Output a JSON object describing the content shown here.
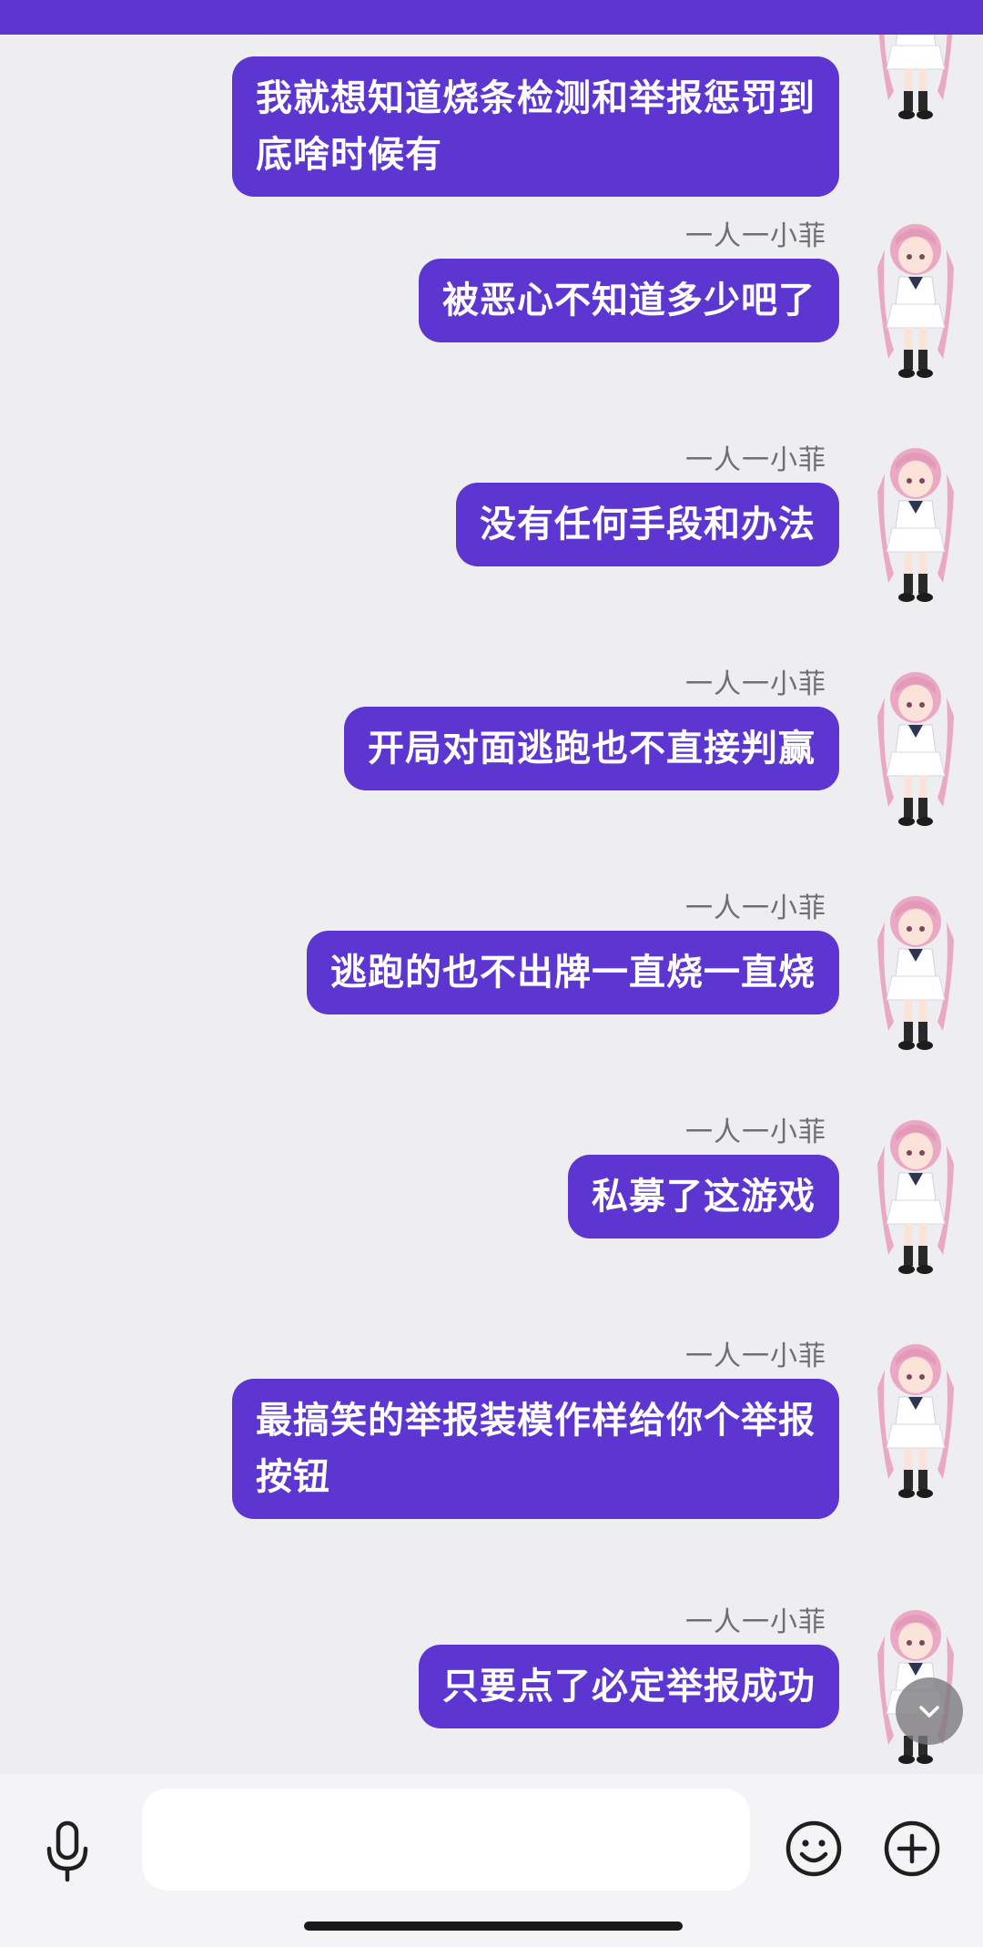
{
  "colors": {
    "bubble": "#5d35d1",
    "bubble_text": "#ffffff",
    "background": "#eeeef0",
    "sender_text": "#6f6f73"
  },
  "messages": [
    {
      "sender": "",
      "text_lines": [
        "我就想知道烧条检测和举报惩罚到",
        "底啥时候有"
      ]
    },
    {
      "sender": "一人一小菲",
      "text_lines": [
        "被恶心不知道多少吧了"
      ]
    },
    {
      "sender": "一人一小菲",
      "text_lines": [
        "没有任何手段和办法"
      ]
    },
    {
      "sender": "一人一小菲",
      "text_lines": [
        "开局对面逃跑也不直接判赢"
      ]
    },
    {
      "sender": "一人一小菲",
      "text_lines": [
        "逃跑的也不出牌一直烧一直烧"
      ]
    },
    {
      "sender": "一人一小菲",
      "text_lines": [
        "私募了这游戏"
      ]
    },
    {
      "sender": "一人一小菲",
      "text_lines": [
        "最搞笑的举报装模作样给你个举报",
        "按钮"
      ]
    },
    {
      "sender": "一人一小菲",
      "text_lines": [
        "只要点了必定举报成功"
      ]
    }
  ],
  "icons": {
    "avatar": "anime-girl-avatar",
    "scroll_down": "chevron-down-icon",
    "voice": "microphone-icon",
    "emoji": "smiley-face-icon",
    "more": "plus-circle-icon"
  },
  "composer": {
    "input_value": "",
    "placeholder": ""
  }
}
